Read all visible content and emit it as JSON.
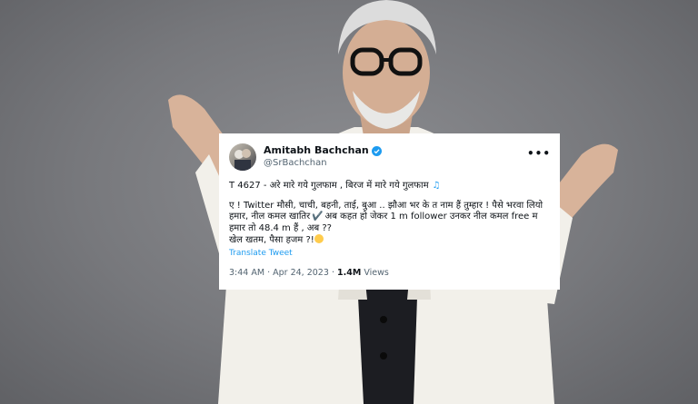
{
  "tweet": {
    "display_name": "Amitabh Bachchan",
    "handle": "@SrBachchan",
    "verified_icon": "verified-badge-icon",
    "more_icon": "more-options-icon",
    "lines": [
      "T 4627 - अरे मारे गये गुलफाम  , बिरज में मारे गये गुलफाम",
      "ए ! Twitter मौसी, चाची, बहनी, ताई, बुआ .. झौआ भर के त नाम हैं तुम्हार  ! पैसे भरवा लियो",
      "हमार, नील कमल खातिर",
      "अब कहत हो  जेकर 1 m follower  उनकर नील कमल free म",
      "हमार तो 48.4 m हैं  , अब  ??",
      "खेल खतम, पैसा हजम ?!"
    ],
    "translate_label": "Translate Tweet",
    "time": "3:44 AM",
    "date": "Apr 24, 2023",
    "views_count": "1.4M",
    "views_label": "Views",
    "accent_color": "#1d9bf0"
  }
}
